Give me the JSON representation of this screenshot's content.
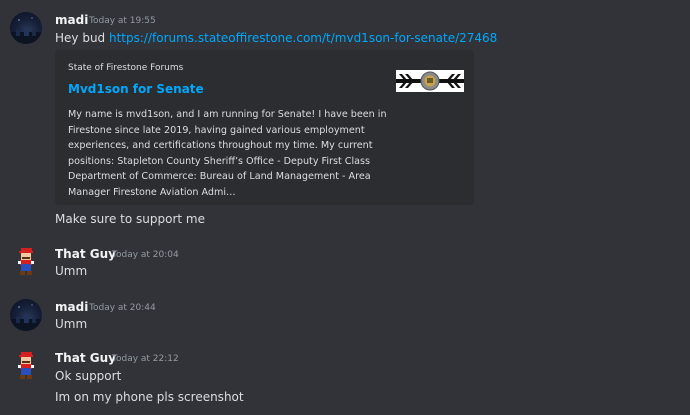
{
  "messages": [
    {
      "username": "madi",
      "timestamp": "Today at 19:55",
      "lines": [
        {
          "prefix": "Hey bud ",
          "link": "https://forums.stateoffirestone.com/t/mvd1son-for-senate/27468"
        }
      ],
      "embed": {
        "provider": "State of Firestone Forums",
        "title": "Mvd1son for Senate",
        "description": "My name is mvd1son, and I am running for Senate! I have been in Firestone since late 2019, having gained various employment experiences, and certifications throughout my time. My current positions: Stapleton County Sheriff’s Office - Deputy First Class Department of Commerce: Bureau of Land Management - Area Manager Firestone Aviation Admi…"
      },
      "after_embed": "Make sure to support me"
    },
    {
      "username": "That Guy",
      "timestamp": "Today at 20:04",
      "text": "Umm"
    },
    {
      "username": "madi",
      "timestamp": "Today at 20:44",
      "text": "Umm"
    },
    {
      "username": "That Guy",
      "timestamp": "Today at 22:12",
      "text": "Ok support",
      "text2": "Im on my phone pls screenshot"
    }
  ],
  "colors": {
    "background": "#313338",
    "embed_background": "#2b2d31",
    "link": "#00a8fc",
    "username": "#f2f3f5",
    "timestamp": "#949ba4",
    "text": "#dbdee1"
  },
  "icons": {
    "madi_avatar": "night-sky-avatar",
    "that_guy_avatar": "mario-avatar",
    "embed_thumbnail": "firestone-seal-banner"
  }
}
